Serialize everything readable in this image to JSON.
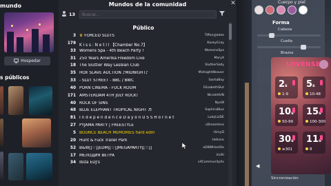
{
  "left": {
    "mundo_label": "mundo",
    "host_button": "Hospedar",
    "public_label": "s públicos"
  },
  "header": {
    "title": "Mundos de la comunidad",
    "user_count": "13",
    "search_placeholder": "Buscar..."
  },
  "section_title": "Público",
  "rooms": [
    {
      "count": "3",
      "name": "FORCED SLUTS",
      "host": "TiffanyJadee",
      "crown": true
    },
    {
      "count": "179",
      "name": "K i s s : N e t l l 【Chamber No.7】",
      "host": "KaseyGray"
    },
    {
      "count": "33",
      "name": "Womens Spa - 4th Beach Party !",
      "host": "WomensSpa"
    },
    {
      "count": "31",
      "name": "250 Years Amerika Freedom Live",
      "host": "MaryX"
    },
    {
      "count": "18",
      "name": "The Sluttier Way Lesbian Club",
      "host": "SluttierSally"
    },
    {
      "count": "35",
      "name": "HOX SLAVE AUCTION ♪MIDNIGHT♪",
      "host": "MidnightWeaver"
    },
    {
      "count": "33",
      "name": "- SLUT STREET -   BBC / BWC",
      "host": "SashaBoy"
    },
    {
      "count": "40",
      "name": "PORN CINEMA - FUCK ROOM",
      "host": "ElizabethSlut"
    },
    {
      "count": "171",
      "name": "AMSTERDAM 4TH JULY ROCK!",
      "host": "NicoleHUN"
    },
    {
      "count": "40",
      "name": "ROCK OF SINS",
      "host": "NyxW"
    },
    {
      "count": "48",
      "name": "BLUE ELEPHANT TROPICAL NIGHT ♬",
      "host": "SaphiraBlue"
    },
    {
      "count": "81",
      "name": "I n d e p e n d e n c e  D a y  o n  U S S  H o r n e t",
      "host": "LadyLizDE"
    },
    {
      "count": "27",
      "name": "PYJAMA PARTY | FREESTYLE",
      "host": "xDreamless"
    },
    {
      "count": "5",
      "name": "BOUNCE BEACH MEMORIES hard edm",
      "host": "HimyD",
      "selected": true
    },
    {
      "count": "20",
      "name": "Hunt & Fuck Trailer Park",
      "host": "Hellvire"
    },
    {
      "count": "52",
      "name": "B&W[[♡]]EDM[[♡]]MEGAPARTY[[♡]]",
      "host": "oDBWHostOo"
    },
    {
      "count": "17",
      "name": "МЕЛОДИЯ ВЕТРА",
      "host": "IrisRi"
    },
    {
      "count": "34",
      "name": "Ibiza EDJ's",
      "host": "xXCommunityXx"
    }
  ],
  "right": {
    "cuerpo_label": "Cuerpo y piel",
    "forma_label": "Forma",
    "sliders": [
      {
        "label": "Cabeza",
        "value": 0.2
      },
      {
        "label": "Cuello",
        "value": 0.75
      },
      {
        "label": "Brazos",
        "value": 0.5
      }
    ],
    "sync_label": "Sincronización",
    "swatch_colors": [
      "#e9dfe0",
      "#d06b78",
      "#d98ab2",
      "#9c5aa0",
      "#ffffff"
    ]
  },
  "lovense": {
    "title": "LOVENSE",
    "tiles": [
      {
        "level": "2",
        "unit": "s",
        "range": "1-9"
      },
      {
        "level": "5",
        "unit": "s",
        "range": "10-48"
      },
      {
        "level": "10",
        "unit": "s",
        "range": "50-99"
      },
      {
        "level": "15",
        "unit": "s",
        "range": "100-300"
      },
      {
        "level": "30",
        "unit": "s",
        "range": "≥301"
      },
      {
        "level": "11",
        "unit": "s",
        "range": "8"
      }
    ]
  }
}
